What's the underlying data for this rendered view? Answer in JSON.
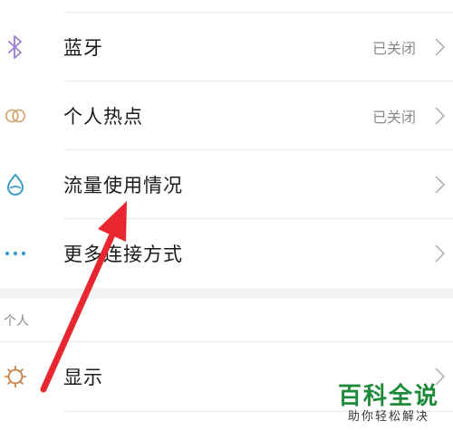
{
  "settings": {
    "rows": [
      {
        "label": "蓝牙",
        "status": "已关闭",
        "icon": "bluetooth-icon"
      },
      {
        "label": "个人热点",
        "status": "已关闭",
        "icon": "hotspot-icon"
      },
      {
        "label": "流量使用情况",
        "status": "",
        "icon": "data-usage-icon"
      },
      {
        "label": "更多连接方式",
        "status": "",
        "icon": "more-dots-icon"
      }
    ],
    "section_personal": {
      "header": "个人",
      "rows": [
        {
          "label": "显示",
          "icon": "display-sun-icon"
        }
      ]
    }
  },
  "watermark": {
    "title": "百科全说",
    "subtitle": "助你轻松解决"
  },
  "colors": {
    "bluetooth_icon": "#9a7fd1",
    "hotspot_icon": "#d8a77a",
    "data_icon": "#3a9fc6",
    "more_icon": "#3a9fc6",
    "display_icon": "#c8864a",
    "annotation_arrow": "#e8262f",
    "watermark": "#1e8a3a"
  }
}
